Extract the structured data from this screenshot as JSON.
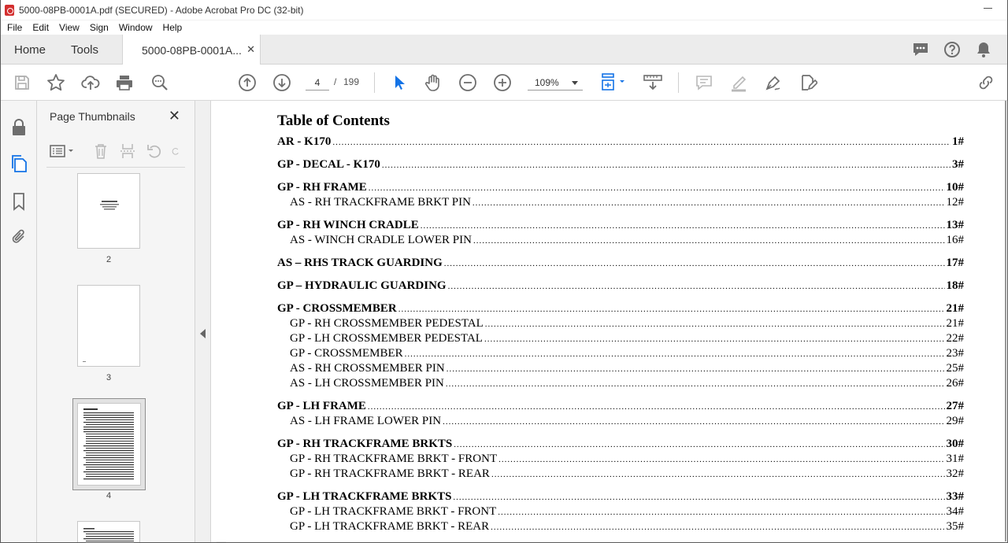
{
  "window": {
    "title": "5000-08PB-0001A.pdf (SECURED) - Adobe Acrobat Pro DC (32-bit)"
  },
  "menu": [
    "File",
    "Edit",
    "View",
    "Sign",
    "Window",
    "Help"
  ],
  "tabs": {
    "home": "Home",
    "tools": "Tools",
    "document": "5000-08PB-0001A..."
  },
  "toolbar": {
    "current_page": "4",
    "separator": "/",
    "total_pages": "199",
    "zoom": "109%"
  },
  "thumbnails_panel": {
    "title": "Page Thumbnails",
    "pages": [
      {
        "label": "2"
      },
      {
        "label": "3"
      },
      {
        "label": "4",
        "selected": true
      }
    ]
  },
  "colors": {
    "accent_blue": "#1473e6",
    "icon_gray": "#6e6e6e"
  },
  "document": {
    "toc_title": "Table of Contents",
    "groups": [
      {
        "entries": [
          {
            "label": "AR - K170",
            "page": "1#",
            "level": "main"
          }
        ]
      },
      {
        "entries": [
          {
            "label": "GP - DECAL - K170",
            "page": "3#",
            "level": "main"
          }
        ]
      },
      {
        "entries": [
          {
            "label": "GP - RH FRAME",
            "page": "10#",
            "level": "main"
          },
          {
            "label": "AS - RH TRACKFRAME BRKT PIN",
            "page": "12#",
            "level": "sub"
          }
        ]
      },
      {
        "entries": [
          {
            "label": "GP - RH WINCH CRADLE",
            "page": "13#",
            "level": "main"
          },
          {
            "label": "AS - WINCH CRADLE LOWER PIN",
            "page": "16#",
            "level": "sub"
          }
        ]
      },
      {
        "entries": [
          {
            "label": "AS – RHS TRACK GUARDING",
            "page": "17#",
            "level": "main"
          }
        ]
      },
      {
        "entries": [
          {
            "label": "GP – HYDRAULIC GUARDING",
            "page": "18#",
            "level": "main"
          }
        ]
      },
      {
        "entries": [
          {
            "label": "GP - CROSSMEMBER",
            "page": "21#",
            "level": "main"
          },
          {
            "label": "GP - RH CROSSMEMBER PEDESTAL",
            "page": "21#",
            "level": "sub"
          },
          {
            "label": "GP - LH CROSSMEMBER PEDESTAL",
            "page": "22#",
            "level": "sub"
          },
          {
            "label": "GP - CROSSMEMBER",
            "page": "23#",
            "level": "sub"
          },
          {
            "label": "AS - RH CROSSMEMBER PIN",
            "page": "25#",
            "level": "sub"
          },
          {
            "label": "AS - LH CROSSMEMBER PIN",
            "page": "26#",
            "level": "sub"
          }
        ]
      },
      {
        "entries": [
          {
            "label": "GP - LH FRAME",
            "page": "27#",
            "level": "main"
          },
          {
            "label": "AS - LH FRAME LOWER PIN",
            "page": "29#",
            "level": "sub"
          }
        ]
      },
      {
        "entries": [
          {
            "label": "GP - RH TRACKFRAME BRKTS",
            "page": "30#",
            "level": "main"
          },
          {
            "label": "GP - RH TRACKFRAME BRKT - FRONT",
            "page": "31#",
            "level": "sub"
          },
          {
            "label": "GP - RH TRACKFRAME BRKT - REAR",
            "page": "32#",
            "level": "sub"
          }
        ]
      },
      {
        "entries": [
          {
            "label": "GP - LH TRACKFRAME BRKTS",
            "page": "33#",
            "level": "main"
          },
          {
            "label": "GP - LH TRACKFRAME BRKT - FRONT",
            "page": "34#",
            "level": "sub"
          },
          {
            "label": "GP - LH TRACKFRAME BRKT - REAR",
            "page": "35#",
            "level": "sub"
          }
        ]
      }
    ]
  }
}
